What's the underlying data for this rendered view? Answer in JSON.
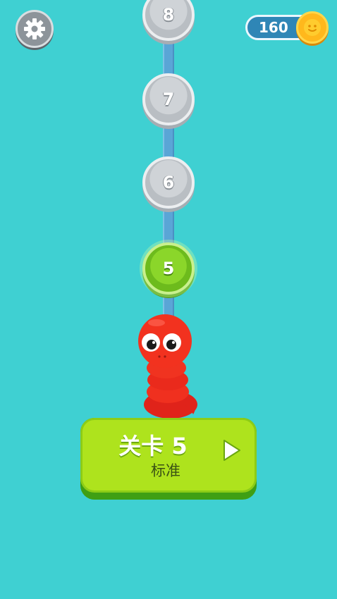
{
  "header": {
    "settings_icon": "gear-icon",
    "coin_count": "160",
    "coin_icon": "coin-face-icon"
  },
  "level_path": {
    "levels": [
      {
        "number": "8",
        "state": "locked"
      },
      {
        "number": "7",
        "state": "locked"
      },
      {
        "number": "6",
        "state": "locked"
      },
      {
        "number": "5",
        "state": "current"
      }
    ]
  },
  "play_button": {
    "title": "关卡 5",
    "mode": "标准",
    "arrow_icon": "play-triangle-icon"
  },
  "colors": {
    "background": "#3fd0d2",
    "current_level": "#7cc823",
    "locked_level": "#c3c8cc",
    "play_button": "#aee31d",
    "worm": "#f0291d"
  }
}
